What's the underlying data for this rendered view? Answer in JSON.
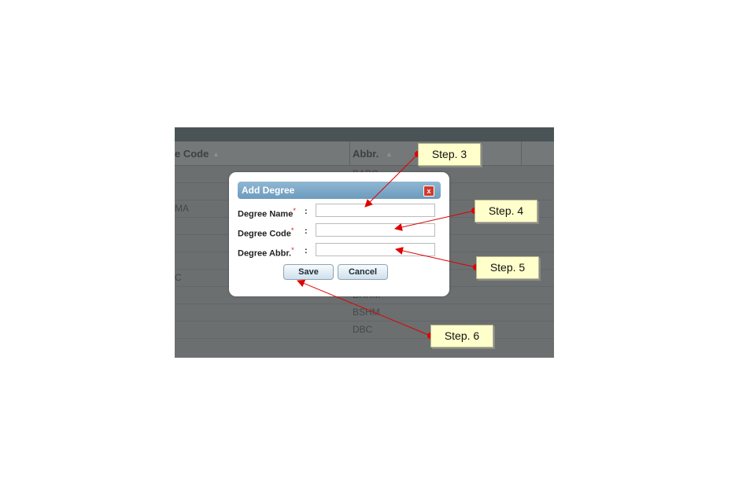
{
  "background_grid": {
    "col_code_header": "e Code",
    "col_abbr_header": "Abbr.",
    "rows_abbr": [
      "BABC",
      "",
      "",
      "",
      "",
      "",
      "BHRM",
      "BSHM",
      "DBC"
    ],
    "rows_code_partial": [
      "MA",
      "C"
    ]
  },
  "dialog": {
    "title": "Add Degree",
    "close_label": "x",
    "fields": [
      {
        "label": "Degree Name",
        "value": ""
      },
      {
        "label": "Degree Code",
        "value": ""
      },
      {
        "label": "Degree Abbr.",
        "value": ""
      }
    ],
    "required_mark": "*",
    "colon": ":",
    "save_label": "Save",
    "cancel_label": "Cancel"
  },
  "annotations": [
    {
      "label": "Step. 3",
      "target": "Degree Name field"
    },
    {
      "label": "Step. 4",
      "target": "Degree Code field"
    },
    {
      "label": "Step. 5",
      "target": "Degree Abbr. field"
    },
    {
      "label": "Step. 6",
      "target": "Save button"
    }
  ],
  "colors": {
    "titlebar": "#7aa7c7",
    "close": "#d03a2c",
    "callout": "#ffffcc",
    "arrow": "#e00000"
  }
}
